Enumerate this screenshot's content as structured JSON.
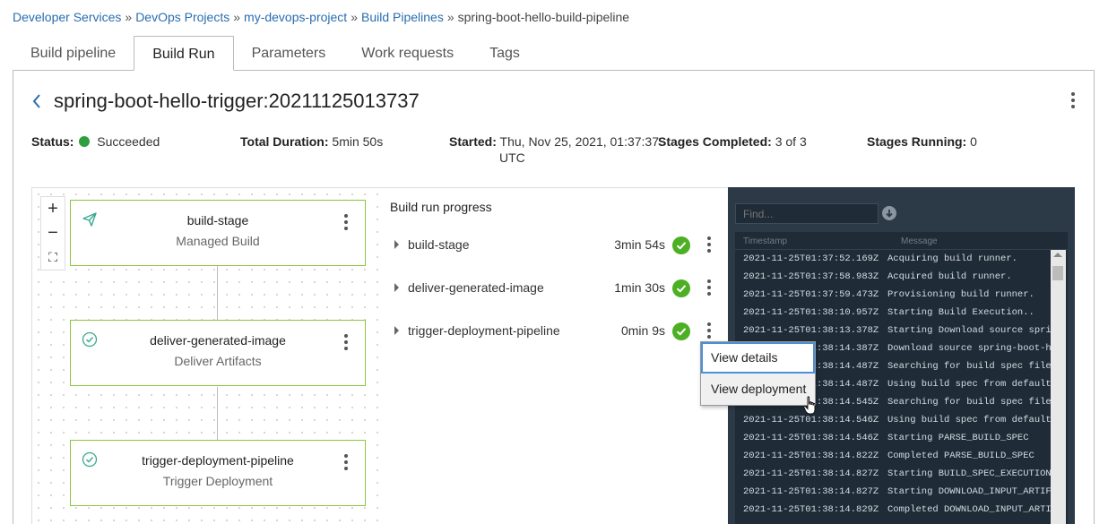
{
  "breadcrumb": {
    "items": [
      "Developer Services",
      "DevOps Projects",
      "my-devops-project",
      "Build Pipelines"
    ],
    "current": "spring-boot-hello-build-pipeline",
    "separator": "»"
  },
  "tabs": [
    "Build pipeline",
    "Build Run",
    "Parameters",
    "Work requests",
    "Tags"
  ],
  "active_tab": "Build Run",
  "run": {
    "title": "spring-boot-hello-trigger:20211125013737"
  },
  "summary": {
    "status_label": "Status:",
    "status_value": "Succeeded",
    "duration_label": "Total Duration:",
    "duration_value": "5min 50s",
    "started_label": "Started:",
    "started_value_line1": "Thu, Nov 25, 2021, 01:37:37",
    "started_value_line2": "UTC",
    "stages_completed_label": "Stages Completed:",
    "stages_completed_value": "3 of 3",
    "stages_running_label": "Stages Running:",
    "stages_running_value": "0"
  },
  "graph": {
    "zoom_in": "+",
    "zoom_out": "−",
    "fit": "⛶",
    "stages": [
      {
        "name": "build-stage",
        "type": "Managed Build",
        "icon": "send-icon"
      },
      {
        "name": "deliver-generated-image",
        "type": "Deliver Artifacts",
        "icon": "check-circle-outline-icon"
      },
      {
        "name": "trigger-deployment-pipeline",
        "type": "Trigger Deployment",
        "icon": "check-circle-outline-icon"
      }
    ]
  },
  "progress": {
    "title": "Build run progress",
    "rows": [
      {
        "name": "build-stage",
        "duration": "3min 54s"
      },
      {
        "name": "deliver-generated-image",
        "duration": "1min 30s"
      },
      {
        "name": "trigger-deployment-pipeline",
        "duration": "0min 9s"
      }
    ]
  },
  "context_menu": {
    "items": [
      "View details",
      "View deployment"
    ]
  },
  "logs": {
    "find_placeholder": "Find...",
    "col_timestamp": "Timestamp",
    "col_message": "Message",
    "rows": [
      {
        "ts": "2021-11-25T01:37:52.169Z",
        "msg": "Acquiring build runner."
      },
      {
        "ts": "2021-11-25T01:37:58.983Z",
        "msg": "Acquired build runner."
      },
      {
        "ts": "2021-11-25T01:37:59.473Z",
        "msg": "Provisioning build runner."
      },
      {
        "ts": "2021-11-25T01:38:10.957Z",
        "msg": "Starting Build Execution.."
      },
      {
        "ts": "2021-11-25T01:38:13.378Z",
        "msg": "Starting Download source sprin"
      },
      {
        "ts": "2021-11-25T01:38:14.387Z",
        "msg": "Download source spring-boot-he"
      },
      {
        "ts": "2021-11-25T01:38:14.487Z",
        "msg": "Searching for build spec file"
      },
      {
        "ts": "2021-11-25T01:38:14.487Z",
        "msg": "Using build spec from default"
      },
      {
        "ts": "2021-11-25T01:38:14.545Z",
        "msg": "Searching for build spec file"
      },
      {
        "ts": "2021-11-25T01:38:14.546Z",
        "msg": "Using build spec from default"
      },
      {
        "ts": "2021-11-25T01:38:14.546Z",
        "msg": "Starting PARSE_BUILD_SPEC"
      },
      {
        "ts": "2021-11-25T01:38:14.822Z",
        "msg": "Completed PARSE_BUILD_SPEC"
      },
      {
        "ts": "2021-11-25T01:38:14.827Z",
        "msg": "Starting BUILD_SPEC_EXECUTION"
      },
      {
        "ts": "2021-11-25T01:38:14.827Z",
        "msg": "Starting DOWNLOAD_INPUT_ARTIFA"
      },
      {
        "ts": "2021-11-25T01:38:14.829Z",
        "msg": "Completed DOWNLOAD_INPUT_ARTIF"
      }
    ]
  },
  "colors": {
    "link": "#2a6db0",
    "success": "#2e9e3e",
    "stage_border": "#8cc63f",
    "log_bg": "#2c3a47"
  }
}
